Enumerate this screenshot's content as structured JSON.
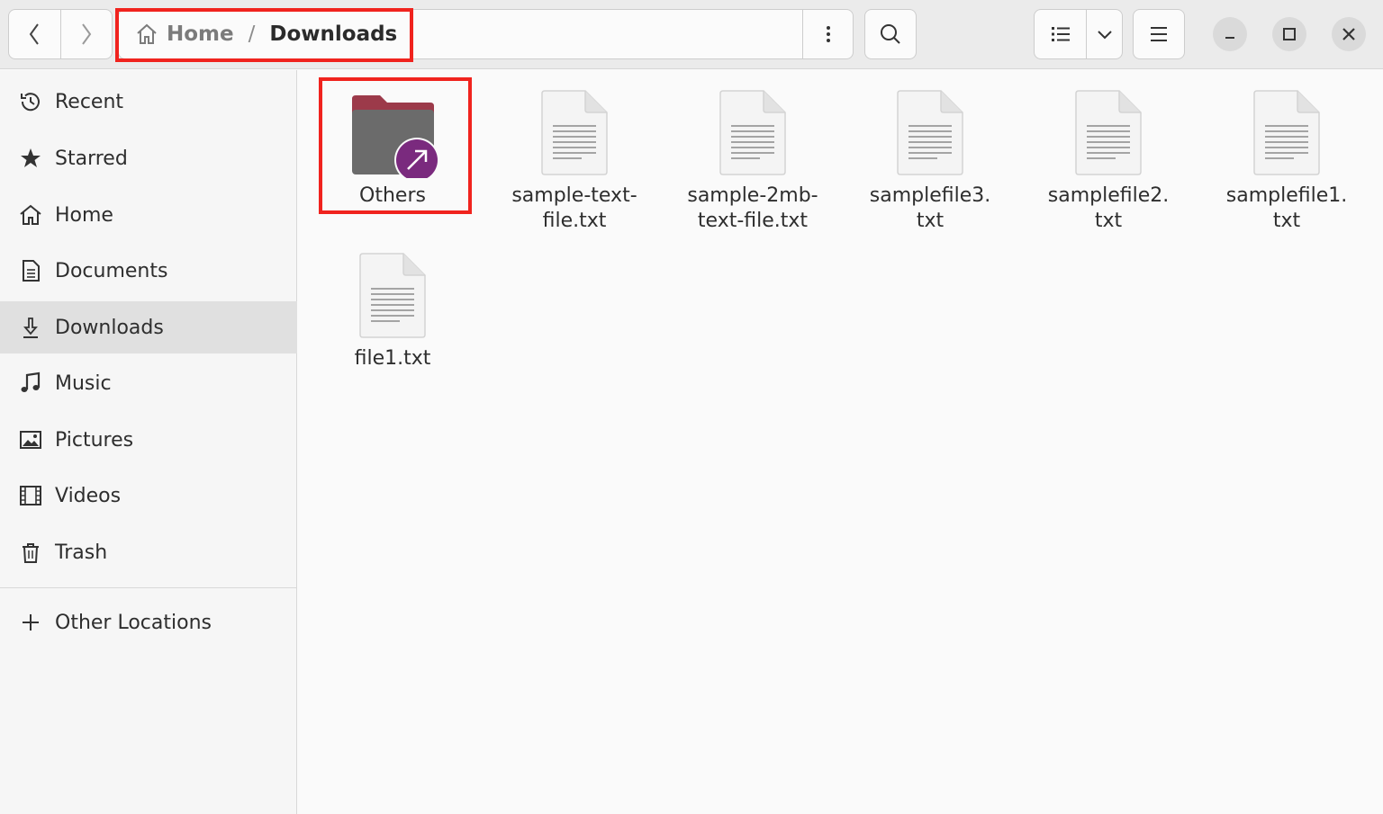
{
  "breadcrumb": {
    "home": "Home",
    "separator": "/",
    "current": "Downloads"
  },
  "sidebar": {
    "items": [
      {
        "label": "Recent",
        "icon": "clock-icon"
      },
      {
        "label": "Starred",
        "icon": "star-icon"
      },
      {
        "label": "Home",
        "icon": "home-icon"
      },
      {
        "label": "Documents",
        "icon": "document-icon"
      },
      {
        "label": "Downloads",
        "icon": "download-icon",
        "selected": true
      },
      {
        "label": "Music",
        "icon": "music-note-icon"
      },
      {
        "label": "Pictures",
        "icon": "picture-icon"
      },
      {
        "label": "Videos",
        "icon": "film-icon"
      },
      {
        "label": "Trash",
        "icon": "trash-icon"
      }
    ],
    "other_locations": {
      "label": "Other Locations",
      "icon": "plus-icon"
    }
  },
  "files": [
    {
      "name": "Others",
      "type": "folder-link"
    },
    {
      "name": "sample-text-\nfile.txt",
      "type": "text"
    },
    {
      "name": "sample-2mb-\ntext-file.txt",
      "type": "text"
    },
    {
      "name": "samplefile3.\ntxt",
      "type": "text"
    },
    {
      "name": "samplefile2.\ntxt",
      "type": "text"
    },
    {
      "name": "samplefile1.\ntxt",
      "type": "text"
    },
    {
      "name": "file1.txt",
      "type": "text"
    }
  ],
  "colors": {
    "highlight": "#f0231e",
    "symlink_badge": "#7a2a7e",
    "folder": "#6b6b6b",
    "folder_tab": "#9c3a4a"
  }
}
